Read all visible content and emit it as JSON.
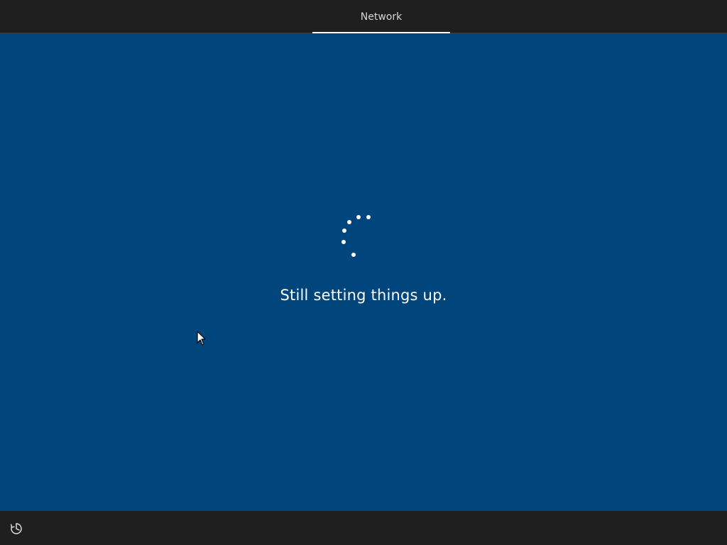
{
  "header": {
    "step_label": "Network"
  },
  "main": {
    "status_text": "Still setting things up."
  },
  "footer": {
    "ease_of_access_icon": "ease-of-access-icon"
  },
  "colors": {
    "background": "#00457c",
    "bars": "#1f1f1f",
    "text": "#ffffff"
  }
}
